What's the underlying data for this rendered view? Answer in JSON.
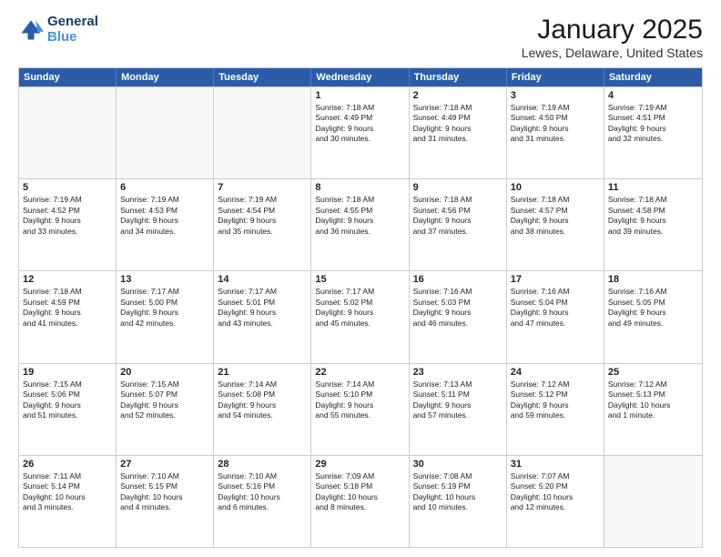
{
  "header": {
    "logo_line1": "General",
    "logo_line2": "Blue",
    "title": "January 2025",
    "subtitle": "Lewes, Delaware, United States"
  },
  "weekdays": [
    "Sunday",
    "Monday",
    "Tuesday",
    "Wednesday",
    "Thursday",
    "Friday",
    "Saturday"
  ],
  "rows": [
    [
      {
        "day": "",
        "info": "",
        "empty": true
      },
      {
        "day": "",
        "info": "",
        "empty": true
      },
      {
        "day": "",
        "info": "",
        "empty": true
      },
      {
        "day": "1",
        "info": "Sunrise: 7:18 AM\nSunset: 4:49 PM\nDaylight: 9 hours\nand 30 minutes.",
        "empty": false
      },
      {
        "day": "2",
        "info": "Sunrise: 7:18 AM\nSunset: 4:49 PM\nDaylight: 9 hours\nand 31 minutes.",
        "empty": false
      },
      {
        "day": "3",
        "info": "Sunrise: 7:19 AM\nSunset: 4:50 PM\nDaylight: 9 hours\nand 31 minutes.",
        "empty": false
      },
      {
        "day": "4",
        "info": "Sunrise: 7:19 AM\nSunset: 4:51 PM\nDaylight: 9 hours\nand 32 minutes.",
        "empty": false
      }
    ],
    [
      {
        "day": "5",
        "info": "Sunrise: 7:19 AM\nSunset: 4:52 PM\nDaylight: 9 hours\nand 33 minutes.",
        "empty": false
      },
      {
        "day": "6",
        "info": "Sunrise: 7:19 AM\nSunset: 4:53 PM\nDaylight: 9 hours\nand 34 minutes.",
        "empty": false
      },
      {
        "day": "7",
        "info": "Sunrise: 7:19 AM\nSunset: 4:54 PM\nDaylight: 9 hours\nand 35 minutes.",
        "empty": false
      },
      {
        "day": "8",
        "info": "Sunrise: 7:18 AM\nSunset: 4:55 PM\nDaylight: 9 hours\nand 36 minutes.",
        "empty": false
      },
      {
        "day": "9",
        "info": "Sunrise: 7:18 AM\nSunset: 4:56 PM\nDaylight: 9 hours\nand 37 minutes.",
        "empty": false
      },
      {
        "day": "10",
        "info": "Sunrise: 7:18 AM\nSunset: 4:57 PM\nDaylight: 9 hours\nand 38 minutes.",
        "empty": false
      },
      {
        "day": "11",
        "info": "Sunrise: 7:18 AM\nSunset: 4:58 PM\nDaylight: 9 hours\nand 39 minutes.",
        "empty": false
      }
    ],
    [
      {
        "day": "12",
        "info": "Sunrise: 7:18 AM\nSunset: 4:59 PM\nDaylight: 9 hours\nand 41 minutes.",
        "empty": false
      },
      {
        "day": "13",
        "info": "Sunrise: 7:17 AM\nSunset: 5:00 PM\nDaylight: 9 hours\nand 42 minutes.",
        "empty": false
      },
      {
        "day": "14",
        "info": "Sunrise: 7:17 AM\nSunset: 5:01 PM\nDaylight: 9 hours\nand 43 minutes.",
        "empty": false
      },
      {
        "day": "15",
        "info": "Sunrise: 7:17 AM\nSunset: 5:02 PM\nDaylight: 9 hours\nand 45 minutes.",
        "empty": false
      },
      {
        "day": "16",
        "info": "Sunrise: 7:16 AM\nSunset: 5:03 PM\nDaylight: 9 hours\nand 46 minutes.",
        "empty": false
      },
      {
        "day": "17",
        "info": "Sunrise: 7:16 AM\nSunset: 5:04 PM\nDaylight: 9 hours\nand 47 minutes.",
        "empty": false
      },
      {
        "day": "18",
        "info": "Sunrise: 7:16 AM\nSunset: 5:05 PM\nDaylight: 9 hours\nand 49 minutes.",
        "empty": false
      }
    ],
    [
      {
        "day": "19",
        "info": "Sunrise: 7:15 AM\nSunset: 5:06 PM\nDaylight: 9 hours\nand 51 minutes.",
        "empty": false
      },
      {
        "day": "20",
        "info": "Sunrise: 7:15 AM\nSunset: 5:07 PM\nDaylight: 9 hours\nand 52 minutes.",
        "empty": false
      },
      {
        "day": "21",
        "info": "Sunrise: 7:14 AM\nSunset: 5:08 PM\nDaylight: 9 hours\nand 54 minutes.",
        "empty": false
      },
      {
        "day": "22",
        "info": "Sunrise: 7:14 AM\nSunset: 5:10 PM\nDaylight: 9 hours\nand 55 minutes.",
        "empty": false
      },
      {
        "day": "23",
        "info": "Sunrise: 7:13 AM\nSunset: 5:11 PM\nDaylight: 9 hours\nand 57 minutes.",
        "empty": false
      },
      {
        "day": "24",
        "info": "Sunrise: 7:12 AM\nSunset: 5:12 PM\nDaylight: 9 hours\nand 59 minutes.",
        "empty": false
      },
      {
        "day": "25",
        "info": "Sunrise: 7:12 AM\nSunset: 5:13 PM\nDaylight: 10 hours\nand 1 minute.",
        "empty": false
      }
    ],
    [
      {
        "day": "26",
        "info": "Sunrise: 7:11 AM\nSunset: 5:14 PM\nDaylight: 10 hours\nand 3 minutes.",
        "empty": false
      },
      {
        "day": "27",
        "info": "Sunrise: 7:10 AM\nSunset: 5:15 PM\nDaylight: 10 hours\nand 4 minutes.",
        "empty": false
      },
      {
        "day": "28",
        "info": "Sunrise: 7:10 AM\nSunset: 5:16 PM\nDaylight: 10 hours\nand 6 minutes.",
        "empty": false
      },
      {
        "day": "29",
        "info": "Sunrise: 7:09 AM\nSunset: 5:18 PM\nDaylight: 10 hours\nand 8 minutes.",
        "empty": false
      },
      {
        "day": "30",
        "info": "Sunrise: 7:08 AM\nSunset: 5:19 PM\nDaylight: 10 hours\nand 10 minutes.",
        "empty": false
      },
      {
        "day": "31",
        "info": "Sunrise: 7:07 AM\nSunset: 5:20 PM\nDaylight: 10 hours\nand 12 minutes.",
        "empty": false
      },
      {
        "day": "",
        "info": "",
        "empty": true
      }
    ]
  ]
}
